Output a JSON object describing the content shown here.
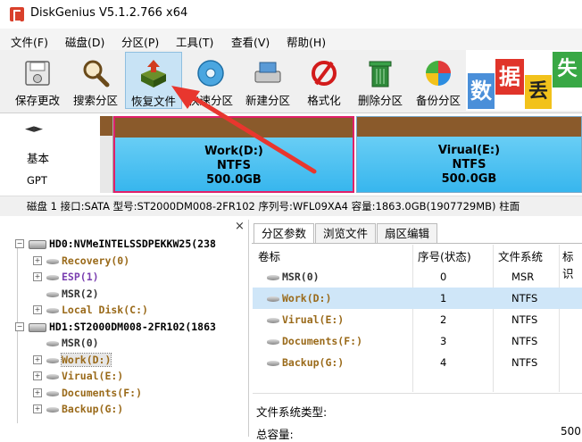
{
  "window": {
    "title": "DiskGenius V5.1.2.766 x64"
  },
  "menu": [
    "文件(F)",
    "磁盘(D)",
    "分区(P)",
    "工具(T)",
    "查看(V)",
    "帮助(H)"
  ],
  "toolbar": [
    "保存更改",
    "搜索分区",
    "恢复文件",
    "快速分区",
    "新建分区",
    "格式化",
    "删除分区",
    "备份分区"
  ],
  "promo": {
    "c1": "数",
    "c2": "据",
    "c3": "丢",
    "c4": "失"
  },
  "disk_side": {
    "nav": "◄►",
    "label1": "基本",
    "label2": "GPT"
  },
  "partitions": [
    {
      "name": "Work(D:)",
      "fs": "NTFS",
      "size": "500.0GB"
    },
    {
      "name": "Virual(E:)",
      "fs": "NTFS",
      "size": "500.0GB"
    }
  ],
  "disk_info": "磁盘 1 接口:SATA  型号:ST2000DM008-2FR102  序列号:WFL09XA4  容量:1863.0GB(1907729MB)  柱面",
  "tree": {
    "close_glyph": "×",
    "items": [
      {
        "text": "HD0:NVMeINTELSSDPEKKW25(238",
        "level": 0,
        "exp": "−"
      },
      {
        "text": "Recovery(0)",
        "level": 1,
        "exp": "+",
        "color": "#9a6a1a"
      },
      {
        "text": "ESP(1)",
        "level": 1,
        "exp": "+",
        "color": "#7a3fb0"
      },
      {
        "text": "MSR(2)",
        "level": 1,
        "exp": "",
        "color": "#333333"
      },
      {
        "text": "Local Disk(C:)",
        "level": 1,
        "exp": "+",
        "color": "#9a6a1a"
      },
      {
        "text": "HD1:ST2000DM008-2FR102(1863",
        "level": 0,
        "exp": "−"
      },
      {
        "text": "MSR(0)",
        "level": 1,
        "exp": "",
        "color": "#333333"
      },
      {
        "text": "Work(D:)",
        "level": 1,
        "exp": "+",
        "color": "#9a6a1a"
      },
      {
        "text": "Virual(E:)",
        "level": 1,
        "exp": "+",
        "color": "#9a6a1a"
      },
      {
        "text": "Documents(F:)",
        "level": 1,
        "exp": "+",
        "color": "#9a6a1a"
      },
      {
        "text": "Backup(G:)",
        "level": 1,
        "exp": "+",
        "color": "#9a6a1a"
      }
    ]
  },
  "tabs": [
    "分区参数",
    "浏览文件",
    "扇区编辑"
  ],
  "table": {
    "headers": [
      "卷标",
      "序号(状态)",
      "文件系统",
      "标识"
    ],
    "rows": [
      {
        "label": "MSR(0)",
        "index": "0",
        "fs": "MSR"
      },
      {
        "label": "Work(D:)",
        "index": "1",
        "fs": "NTFS"
      },
      {
        "label": "Virual(E:)",
        "index": "2",
        "fs": "NTFS"
      },
      {
        "label": "Documents(F:)",
        "index": "3",
        "fs": "NTFS"
      },
      {
        "label": "Backup(G:)",
        "index": "4",
        "fs": "NTFS"
      }
    ]
  },
  "details": {
    "fs_type_label": "文件系统类型:",
    "capacity_label": "总容量:",
    "capacity_value": "500"
  }
}
